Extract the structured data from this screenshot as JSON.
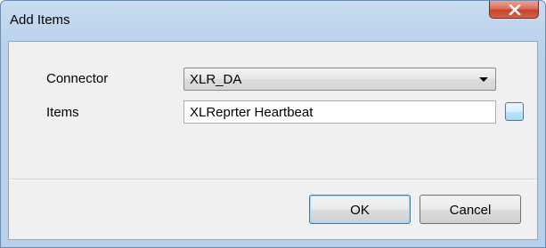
{
  "window": {
    "title": "Add Items"
  },
  "form": {
    "connector_label": "Connector",
    "connector_value": "XLR_DA",
    "items_label": "Items",
    "items_value": "XLReprter Heartbeat"
  },
  "buttons": {
    "ok": "OK",
    "cancel": "Cancel"
  },
  "icons": {
    "close": "close-icon",
    "dropdown": "chevron-down-icon",
    "browse": "browse-icon"
  },
  "colors": {
    "title_bar": "#c9dcf0",
    "close_button": "#c7432b",
    "client_background": "#f0f0f0",
    "focus_border": "#3c7fb1"
  }
}
